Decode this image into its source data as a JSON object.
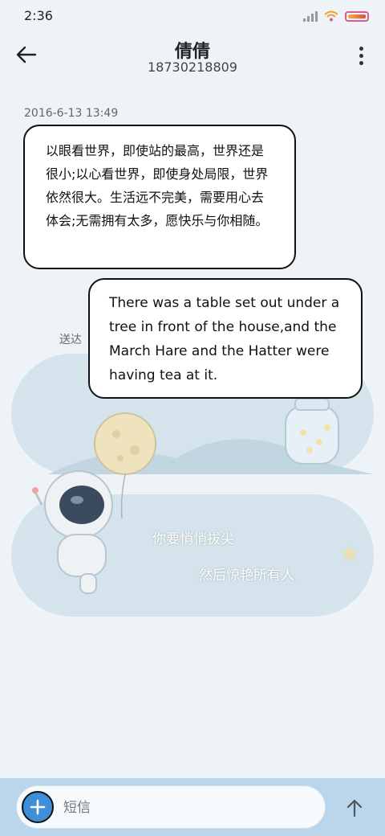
{
  "status": {
    "time": "2:36"
  },
  "header": {
    "contact_name": "倩倩",
    "phone": "18730218809"
  },
  "thread": {
    "timestamp": "2016-6-13 13:49",
    "incoming": "以眼看世界，即使站的最高，世界还是很小;以心看世界，即使身处局限，世界依然很大。生活远不完美，需要用心去体会;无需拥有太多，愿快乐与你相随。",
    "outgoing": "There was a table set out under a tree in front of the house,and the March Hare and the Hatter were having tea at it.",
    "sent_status": "送达"
  },
  "background": {
    "line1": "你要悄悄拔尖",
    "line2": "然后惊艳所有人"
  },
  "composer": {
    "placeholder": "短信"
  },
  "icons": [
    "back-arrow-icon",
    "more-vert-icon",
    "add-icon",
    "send-arrow-icon",
    "signal-icon",
    "wifi-icon",
    "battery-icon"
  ]
}
